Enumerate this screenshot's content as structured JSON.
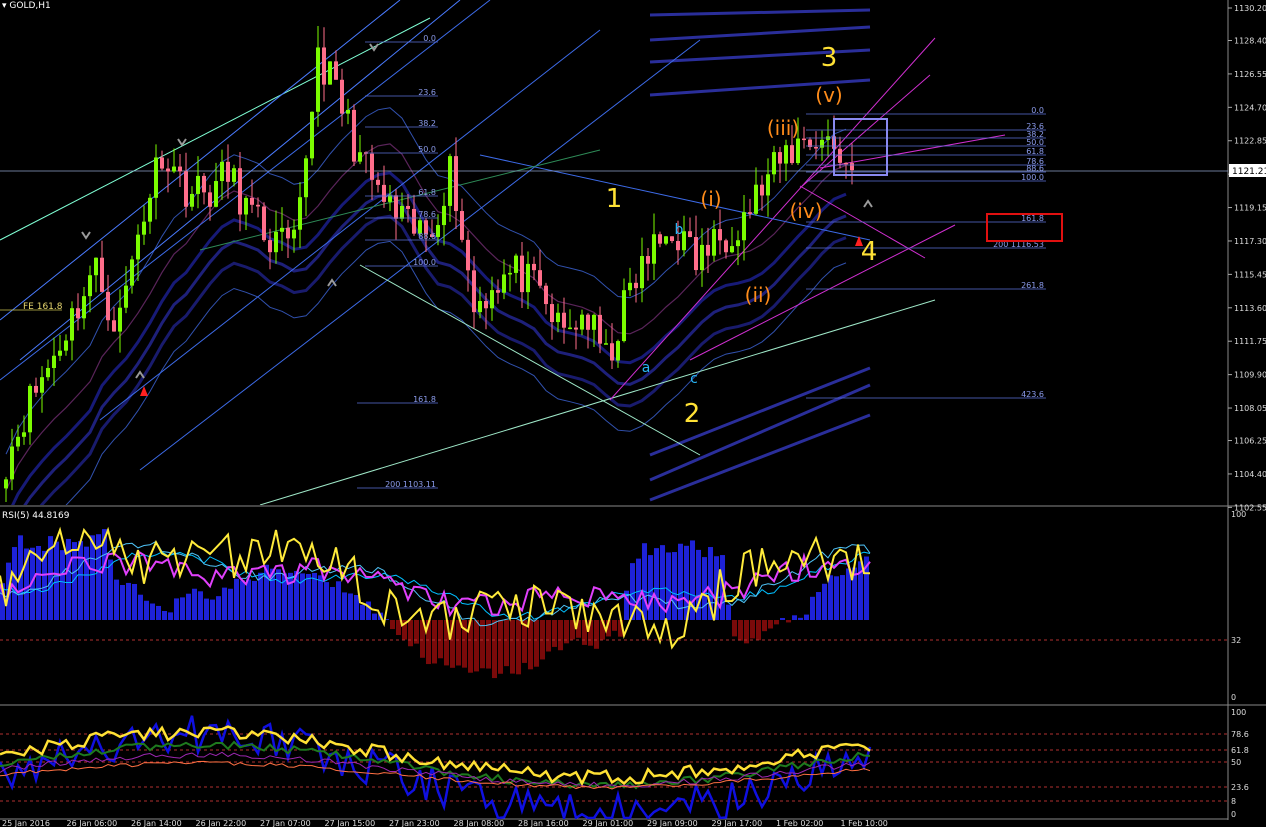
{
  "window": {
    "symbol": "GOLD,H1"
  },
  "main_panel": {
    "price_axis": [
      1130.2,
      1128.4,
      1126.55,
      1124.7,
      1122.85,
      1121.0,
      1119.15,
      1117.3,
      1115.45,
      1113.6,
      1111.75,
      1109.9,
      1108.05,
      1106.25,
      1104.4,
      1102.55
    ],
    "current_price": "1121.21",
    "fe_label": "FE 161.8",
    "wave_labels": {
      "major": [
        "1",
        "2",
        "3",
        "4"
      ],
      "minor": [
        "(i)",
        "(ii)",
        "(iii)",
        "(iv)",
        "(v)"
      ],
      "abc": [
        "a",
        "b",
        "c"
      ]
    },
    "fib_retracement_1": [
      "0.0",
      "23.6",
      "38.2",
      "50.0",
      "61.8",
      "78.6",
      "88.6",
      "100.0",
      "161.8",
      "200 1103.11"
    ],
    "fib_retracement_2": [
      "0.0",
      "23.6",
      "38.2",
      "50.0",
      "61.8",
      "78.6",
      "88.6",
      "100.0",
      "161.8",
      "200 1116.53",
      "261.8",
      "423.6"
    ],
    "colors": {
      "up_candle": "#7CFC00",
      "down_candle": "#FF6E8A",
      "wave_major": "#FFE135",
      "wave_minor": "#FF8C1A",
      "abc": "#29B6F6",
      "highlight_box": "#E01010"
    }
  },
  "rsi_panel": {
    "title": "RSI(5) 44.8169",
    "axis": [
      "100",
      "32",
      "0"
    ],
    "histogram_colors": {
      "positive": "#1E22D8",
      "negative": "#7A0A0A"
    }
  },
  "osc_panel": {
    "axis": [
      "100",
      "78.6",
      "61.8",
      "50",
      "23.6",
      "8",
      "0"
    ]
  },
  "time_axis": [
    "25 Jan 2016",
    "26 Jan 06:00",
    "26 Jan 14:00",
    "26 Jan 22:00",
    "27 Jan 07:00",
    "27 Jan 15:00",
    "27 Jan 23:00",
    "28 Jan 08:00",
    "28 Jan 16:00",
    "29 Jan 01:00",
    "29 Jan 09:00",
    "29 Jan 17:00",
    "1 Feb 02:00",
    "1 Feb 10:00"
  ],
  "chart_data": {
    "type": "candlestick",
    "symbol": "GOLD",
    "timeframe": "H1",
    "ylim": [
      1102.55,
      1130.2
    ],
    "series": [
      {
        "name": "price",
        "values": [
          1105.2,
          1108.3,
          1110.6,
          1113.2,
          1115.8,
          1112.4,
          1118.1,
          1122.4,
          1120.3,
          1119.9,
          1121.0,
          1118.7,
          1117.2,
          1116.8,
          1127.8,
          1125.0,
          1121.5,
          1119.4,
          1118.0,
          1117.6,
          1121.5,
          1113.6,
          1115.1,
          1115.6,
          1114.2,
          1112.1,
          1113.3,
          1110.6,
          1114.5,
          1116.7,
          1118.0,
          1116.2,
          1117.4,
          1118.5,
          1120.3,
          1122.0,
          1123.1,
          1122.8,
          1121.2
        ]
      }
    ]
  }
}
